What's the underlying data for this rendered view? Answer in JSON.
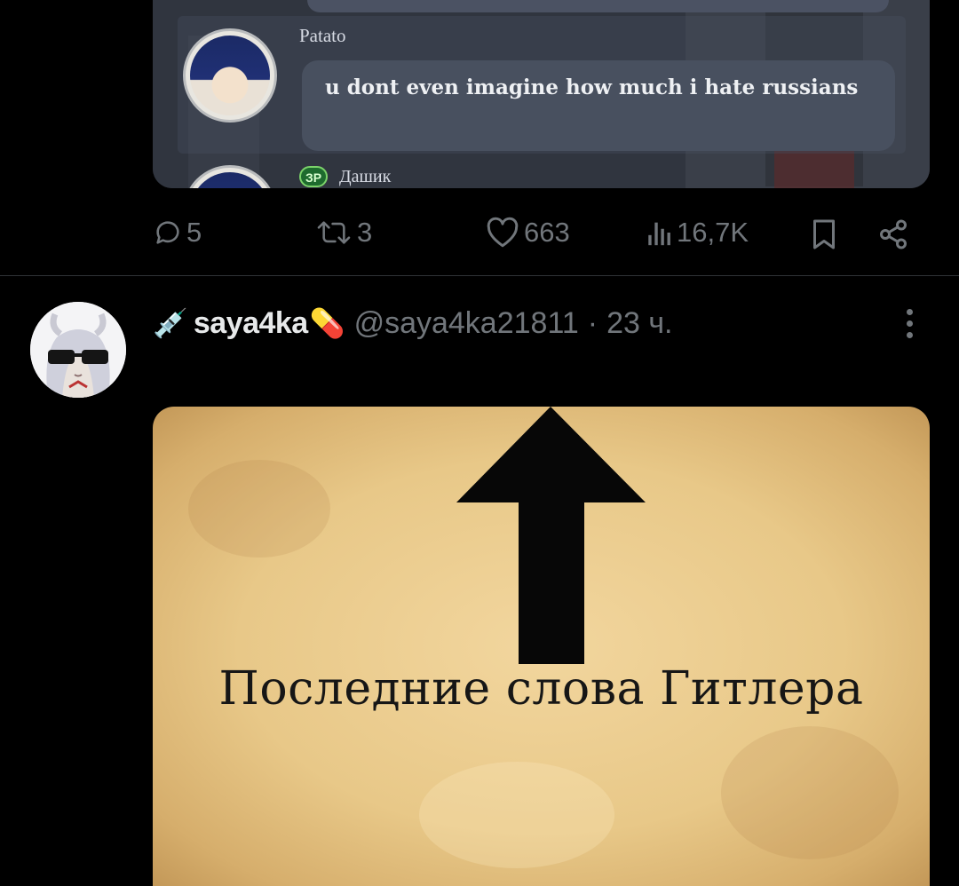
{
  "post1": {
    "chat": {
      "messages": [
        {
          "author": "Patato",
          "text": "u dont even imagine how much i hate russians"
        },
        {
          "author": "Дашик",
          "badge": "ЗР"
        }
      ]
    },
    "actions": {
      "replies": "5",
      "reposts": "3",
      "likes": "663",
      "views": "16,7K"
    }
  },
  "post2": {
    "display_name": "saya4ka",
    "name_prefix_emoji": "💉",
    "name_suffix_emoji": "💊",
    "handle": "@saya4ka21811",
    "separator": "·",
    "time": "23 ч.",
    "image": {
      "caption": "Последние слова Гитлера",
      "arrow": "up-arrow"
    }
  },
  "colors": {
    "background": "#000000",
    "muted": "#71767b",
    "text": "#e7e9ea",
    "divider": "#2f3336",
    "parchment": "#e8c888"
  },
  "icons": [
    "reply-icon",
    "repost-icon",
    "like-icon",
    "views-icon",
    "bookmark-icon",
    "share-icon",
    "more-icon"
  ]
}
